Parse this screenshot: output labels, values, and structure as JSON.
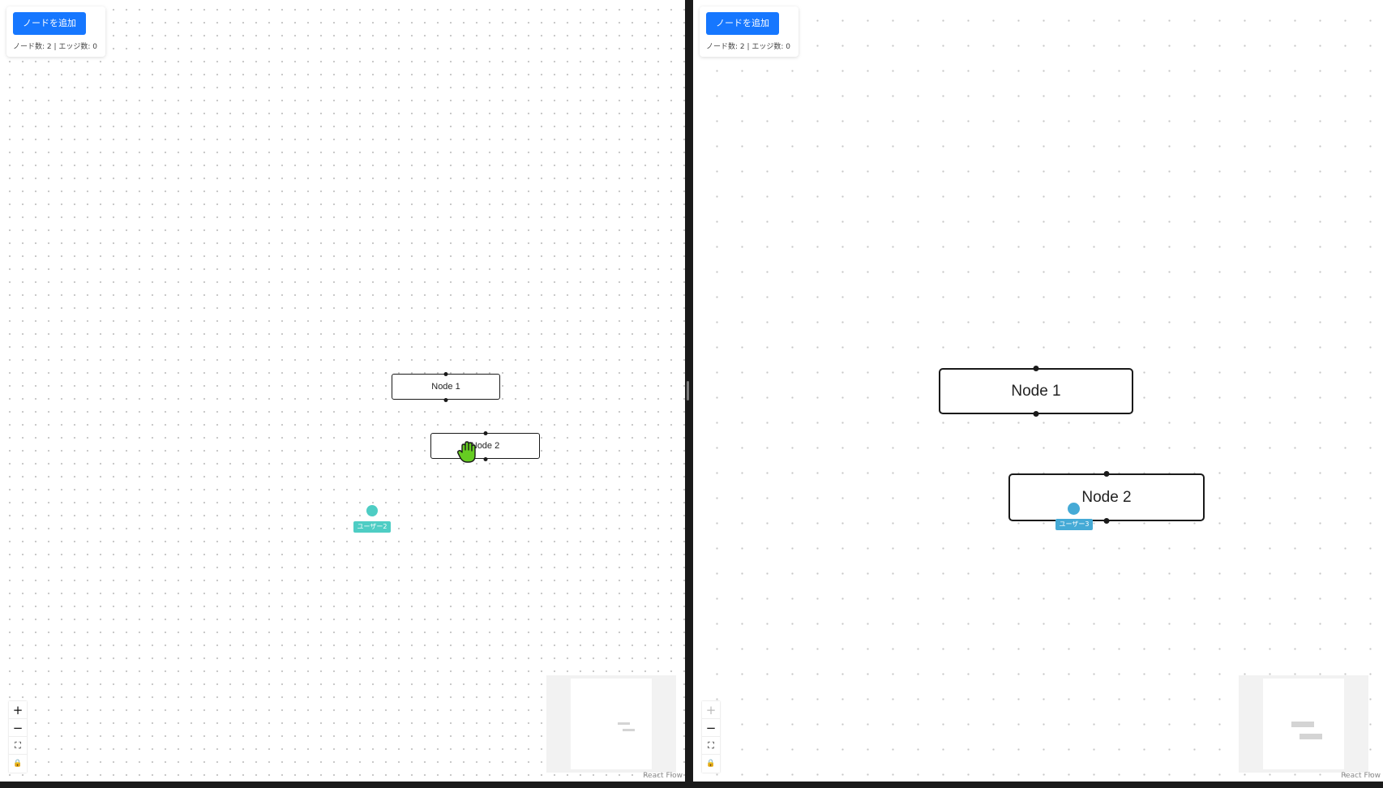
{
  "panes": {
    "left": {
      "add_button": "ノードを追加",
      "counts": "ノード数: 2 | エッジ数: 0",
      "nodes": [
        "Node 1",
        "Node 2"
      ],
      "remote_cursor": {
        "label": "ユーザー2",
        "color": "#4ecdc4"
      },
      "attribution": "React Flow"
    },
    "right": {
      "add_button": "ノードを追加",
      "counts": "ノード数: 2 | エッジ数: 0",
      "nodes": [
        "Node 1",
        "Node 2"
      ],
      "remote_cursor": {
        "label": "ユーザー3",
        "color": "#45aad6"
      },
      "attribution": "React Flow"
    }
  },
  "controls": {
    "zoom_in": "+",
    "zoom_out": "−",
    "fit_view": "⛶",
    "lock": "🔒"
  },
  "colors": {
    "accent": "#1677ff",
    "node_border": "#1a1a1a",
    "minimap_bg": "#f2f2f2"
  },
  "icons": [
    "plus-icon",
    "minus-icon",
    "fit-view-icon",
    "lock-icon",
    "grab-hand-cursor-icon"
  ]
}
